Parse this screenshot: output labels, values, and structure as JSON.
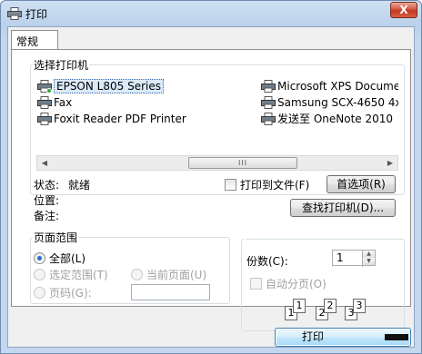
{
  "window": {
    "title": "打印",
    "close_label": "X"
  },
  "tabs": [
    {
      "label": "常规"
    }
  ],
  "select_printer": {
    "legend": "选择打印机",
    "printers": [
      {
        "name": "EPSON L805 Series",
        "selected": true
      },
      {
        "name": "Fax"
      },
      {
        "name": "Foxit Reader PDF Printer"
      },
      {
        "name": "Microsoft XPS Docume"
      },
      {
        "name": "Samsung SCX-4650 4x"
      },
      {
        "name": "发送至 OneNote 2010"
      }
    ],
    "scroll_thumb_grip": "III",
    "status_label": "状态:",
    "status_value": "就绪",
    "location_label": "位置:",
    "comment_label": "备注:",
    "print_to_file_label": "打印到文件(F)",
    "preferences_button": "首选项(R)",
    "find_printer_button": "查找打印机(D)..."
  },
  "page_range": {
    "legend": "页面范围",
    "all_label": "全部(L)",
    "selection_label": "选定范围(T)",
    "current_page_label": "当前页面(U)",
    "pages_label": "页码(G):",
    "pages_value": ""
  },
  "copies": {
    "count_label": "份数(C):",
    "count_value": "1",
    "collate_label": "自动分页(O)",
    "collate_pages": [
      "1",
      "1",
      "2",
      "2",
      "3",
      "3"
    ]
  },
  "footer": {
    "print_button": "打印"
  }
}
